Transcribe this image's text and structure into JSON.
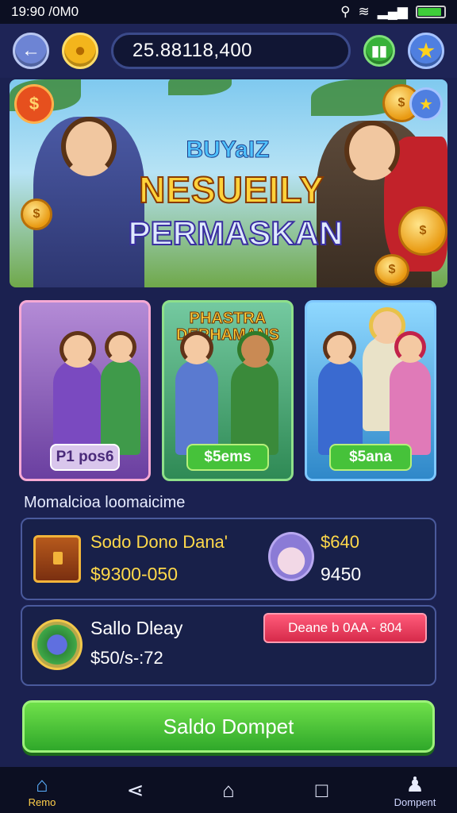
{
  "status": {
    "time": "19:90 /0M0"
  },
  "header": {
    "balance": "25.88118,400"
  },
  "banner": {
    "title_small": "BUYaIZ",
    "title_big": "NESUEILY",
    "title_sub": "PERMASKAN"
  },
  "cards": [
    {
      "top_label": "",
      "price": "P1 pos6"
    },
    {
      "top_label": "PHASTRA DERHAMANS",
      "price": "$5ems"
    },
    {
      "top_label": "",
      "price": "$5ana"
    }
  ],
  "info": {
    "section_title": "Momalcioa loomaicime",
    "row1": {
      "title": "Sodo Dono Dana'",
      "amount": "$9300-050",
      "side_title": "$640",
      "side_amount": "9450"
    },
    "row2": {
      "title": "Sallo Dleay",
      "amount": "$50/s-:72",
      "pill": "Deane b 0AA - 804"
    }
  },
  "cta": {
    "label": "Saldo Dompet"
  },
  "nav": {
    "left_label": "Remo",
    "right_label": "Dompent"
  }
}
